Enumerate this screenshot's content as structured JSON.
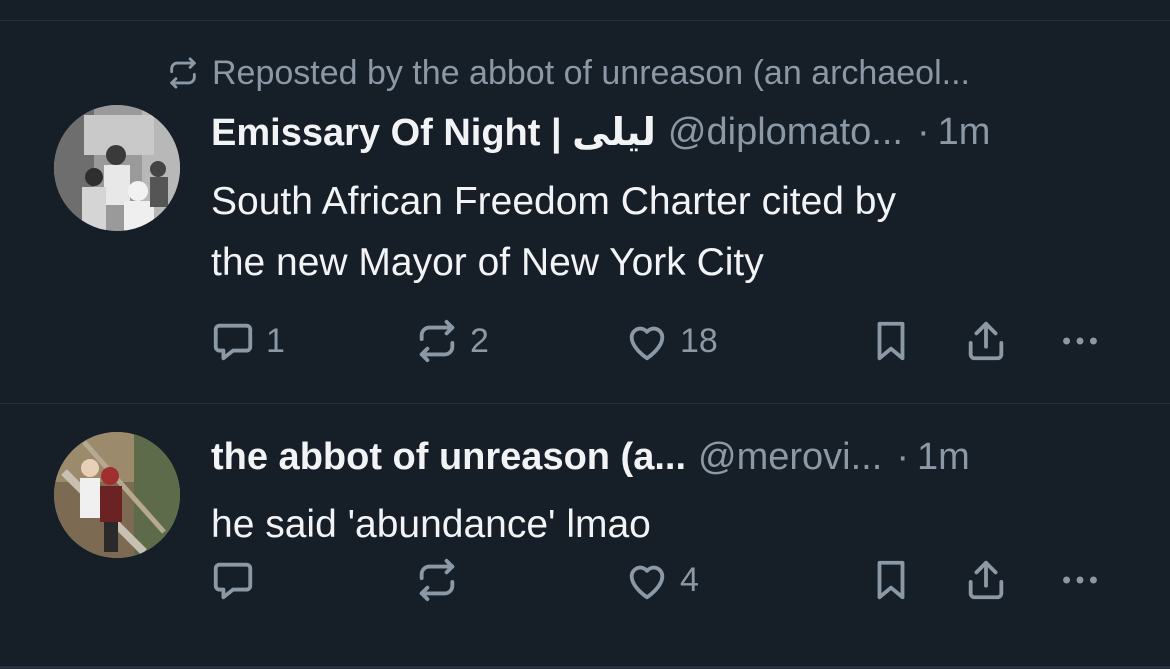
{
  "posts": [
    {
      "repost_text": "Reposted by the abbot of unreason (an archaeol...",
      "display_name": "Emissary Of Night | ليلى",
      "handle": "@diplomato...",
      "dot": "·",
      "time": "1m",
      "text_lines": [
        "South African Freedom Charter cited by",
        "the new Mayor of New York City"
      ],
      "counts": {
        "replies": "1",
        "reposts": "2",
        "likes": "18"
      }
    },
    {
      "display_name": "the abbot of unreason (a...",
      "handle": "@merovi...",
      "dot": "·",
      "time": "1m",
      "text_lines": [
        "he said 'abundance' lmao"
      ],
      "counts": {
        "likes": "4"
      }
    }
  ],
  "icons": {
    "repost": "repost-icon",
    "reply": "reply-icon",
    "like": "heart-icon",
    "bookmark": "bookmark-icon",
    "share": "share-icon",
    "more": "more-icon"
  },
  "colors": {
    "background": "#161e27",
    "muted": "#8b98a5",
    "text": "#f1f3f5",
    "divider": "#26313d"
  }
}
